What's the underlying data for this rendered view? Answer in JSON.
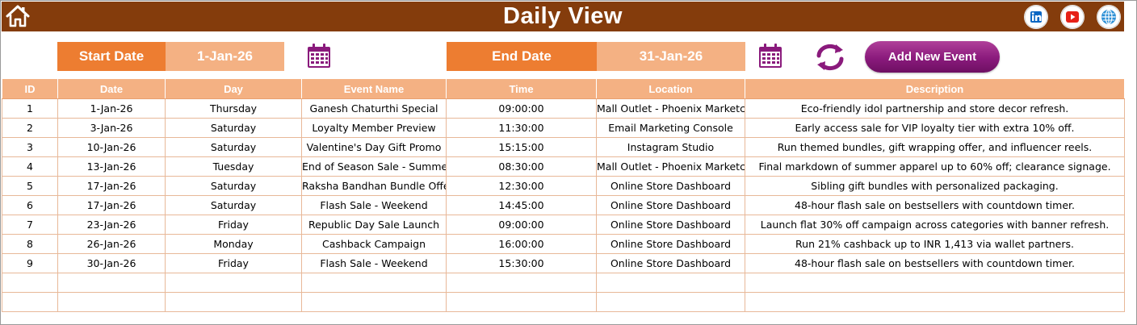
{
  "header": {
    "title": "Daily View",
    "bg_color": "#843c0c",
    "home_icon": "home-icon",
    "social_links": [
      {
        "name": "linkedin",
        "icon": "linkedin-icon",
        "label": "in",
        "color": "#0a66c2"
      },
      {
        "name": "youtube",
        "icon": "youtube-icon",
        "label": "",
        "color": "#e62117"
      },
      {
        "name": "website",
        "icon": "globe-icon",
        "label": "",
        "color": "#2b8fd6"
      }
    ]
  },
  "filters": {
    "start_label": "Start Date",
    "start_value": "1-Jan-26",
    "end_label": "End Date",
    "end_value": "31-Jan-26",
    "label_color": "#ed7d31",
    "value_color": "#f4b183"
  },
  "actions": {
    "add_event_label": "Add New Event",
    "refresh_icon": "refresh-icon",
    "calendar_icon": "calendar-icon",
    "accent_color": "#8a1a7c"
  },
  "table": {
    "columns": [
      "ID",
      "Date",
      "Day",
      "Event Name",
      "Time",
      "Location",
      "Description"
    ],
    "rows": [
      [
        "1",
        "1-Jan-26",
        "Thursday",
        "Ganesh Chaturthi Special",
        "09:00:00",
        "Mall Outlet - Phoenix Marketcit",
        "Eco-friendly idol partnership and store decor refresh."
      ],
      [
        "2",
        "3-Jan-26",
        "Saturday",
        "Loyalty Member Preview",
        "11:30:00",
        "Email Marketing Console",
        "Early access sale for VIP loyalty tier with extra 10% off."
      ],
      [
        "3",
        "10-Jan-26",
        "Saturday",
        "Valentine's Day Gift Promo",
        "15:15:00",
        "Instagram Studio",
        "Run themed bundles, gift wrapping offer, and influencer reels."
      ],
      [
        "4",
        "13-Jan-26",
        "Tuesday",
        "End of Season Sale - Summer",
        "08:30:00",
        "Mall Outlet - Phoenix Marketcit",
        "Final markdown of summer apparel up to 60% off; clearance signage."
      ],
      [
        "5",
        "17-Jan-26",
        "Saturday",
        "Raksha Bandhan Bundle Offer",
        "12:30:00",
        "Online Store Dashboard",
        "Sibling gift bundles with personalized packaging."
      ],
      [
        "6",
        "17-Jan-26",
        "Saturday",
        "Flash Sale - Weekend",
        "14:45:00",
        "Online Store Dashboard",
        "48-hour flash sale on bestsellers with countdown timer."
      ],
      [
        "7",
        "23-Jan-26",
        "Friday",
        "Republic Day Sale Launch",
        "09:00:00",
        "Online Store Dashboard",
        "Launch flat 30% off campaign across categories with banner refresh."
      ],
      [
        "8",
        "26-Jan-26",
        "Monday",
        "Cashback Campaign",
        "16:00:00",
        "Online Store Dashboard",
        "Run 21% cashback up to INR 1,413 via wallet partners."
      ],
      [
        "9",
        "30-Jan-26",
        "Friday",
        "Flash Sale - Weekend",
        "15:30:00",
        "Online Store Dashboard",
        "48-hour flash sale on bestsellers with countdown timer."
      ]
    ],
    "empty_rows": 2,
    "header_color": "#f4b183",
    "border_color": "#e8b898"
  }
}
